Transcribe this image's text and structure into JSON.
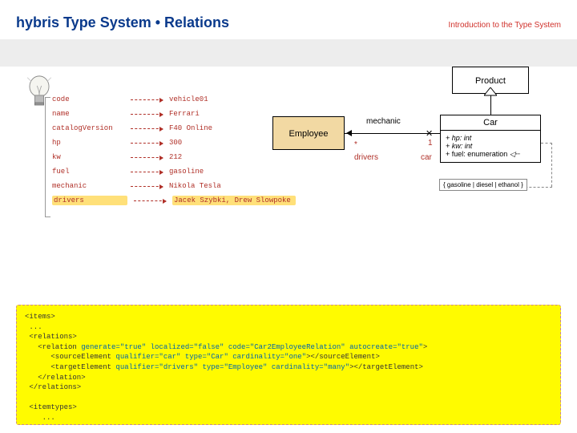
{
  "header": {
    "title": "hybris Type System • Relations",
    "subtitle": "Introduction to the Type System"
  },
  "attributes": [
    {
      "label": "code",
      "value": "vehicle01"
    },
    {
      "label": "name",
      "value": "Ferrari"
    },
    {
      "label": "catalogVersion",
      "value": "F40 Online"
    },
    {
      "label": "hp",
      "value": "300"
    },
    {
      "label": "kw",
      "value": "212"
    },
    {
      "label": "fuel",
      "value": "gasoline"
    },
    {
      "label": "mechanic",
      "value": "Nikola Tesla"
    },
    {
      "label": "drivers",
      "value": "Jacek Szybki, Drew Slowpoke",
      "hl": true
    }
  ],
  "uml": {
    "product": "Product",
    "car": {
      "title": "Car",
      "attrs": [
        "+ hp: int",
        "+ kw: int",
        "+ fuel: enumeration"
      ]
    },
    "employee": "Employee",
    "assoc": {
      "name": "mechanic",
      "sourceMulti": "*",
      "targetMulti": "1",
      "sourceRole": "drivers",
      "targetRole": "car"
    },
    "enum": "{ gasoline | diesel | ethanol }"
  },
  "code": {
    "l1": "<items>",
    "l2": " ...",
    "l3": " <relations>",
    "l4a": "   <relation ",
    "l4b": "generate=\"true\" localized=\"false\" code=\"Car2EmployeeRelation\" autocreate=\"true\"",
    "l4c": ">",
    "l5a": "      <sourceElement ",
    "l5b": "qualifier=\"car\" type=\"Car\" cardinality=\"one\"",
    "l5c": "></sourceElement>",
    "l6a": "      <targetElement ",
    "l6b": "qualifier=\"drivers\" type=\"Employee\" cardinality=\"many\"",
    "l6c": "></targetElement>",
    "l7": "   </relation>",
    "l8": " </relations>",
    "l9": "",
    "l10": " <itemtypes>",
    "l11": "    ..."
  }
}
